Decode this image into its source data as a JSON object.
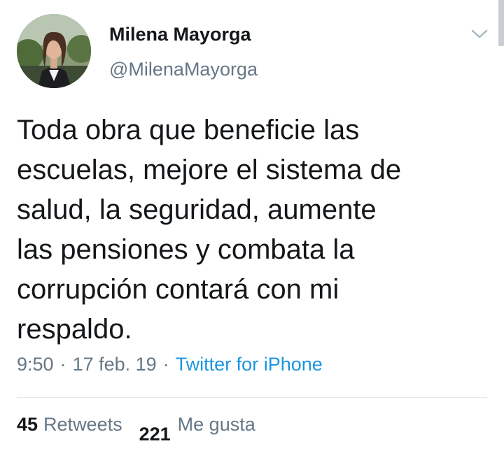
{
  "user": {
    "name": "Milena Mayorga",
    "handle": "@MilenaMayorga"
  },
  "tweet": {
    "text": "Toda obra que beneficie las\nescuelas, mejore el sistema de\nsalud, la seguridad, aumente\nlas  pensiones y combata la\ncorrupción contará con mi\nrespaldo.",
    "time": "9:50",
    "date": "17 feb. 19",
    "separator": "·",
    "source": "Twitter for iPhone"
  },
  "stats": {
    "retweets_count": "45",
    "retweets_label": "Retweets",
    "likes_count": "221",
    "likes_label": "Me gusta"
  },
  "icons": {
    "caret": "chevron-down-icon"
  },
  "colors": {
    "text": "#14171a",
    "secondary": "#657786",
    "link": "#1b95e0",
    "divider": "#e1e8ed"
  }
}
